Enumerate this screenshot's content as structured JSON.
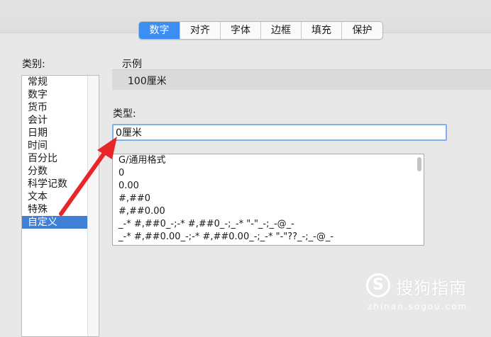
{
  "tabs": [
    {
      "label": "数字",
      "active": true
    },
    {
      "label": "对齐",
      "active": false
    },
    {
      "label": "字体",
      "active": false
    },
    {
      "label": "边框",
      "active": false
    },
    {
      "label": "填充",
      "active": false
    },
    {
      "label": "保护",
      "active": false
    }
  ],
  "category": {
    "label": "类别:",
    "items": [
      "常规",
      "数字",
      "货币",
      "会计",
      "日期",
      "时间",
      "百分比",
      "分数",
      "科学记数",
      "文本",
      "特殊",
      "自定义"
    ],
    "selected": "自定义"
  },
  "sample": {
    "label": "示例",
    "value": "100厘米"
  },
  "type": {
    "label": "类型:",
    "value": "0厘米"
  },
  "formats": [
    "G/通用格式",
    "0",
    "0.00",
    "#,##0",
    "#,##0.00",
    "_-* #,##0_-;-* #,##0_-;_-* \"-\"_-;_-@_-",
    "_-* #,##0.00_-;-* #,##0.00_-;_-* \"-\"??_-;_-@_-"
  ],
  "watermark": {
    "logo": "S",
    "text": "搜狗指南",
    "url": "zhinan.sogou.com"
  },
  "colors": {
    "accent": "#3c8ef0",
    "selection": "#3f7fd6",
    "arrow": "#e8262a"
  }
}
